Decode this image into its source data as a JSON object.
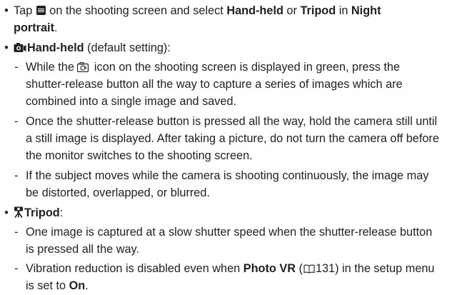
{
  "b1": {
    "pre": "Tap ",
    "mid1": " on the shooting screen and select ",
    "opt1": "Hand-held",
    "or": " or ",
    "opt2": "Tripod",
    "in": " in ",
    "mode_l1": "Night",
    "mode_l2": "portrait",
    "end": "."
  },
  "b2": {
    "label": "Hand-held",
    "suffix": " (default setting):",
    "d1_l1a": "While the ",
    "d1_l1b": " icon on the shooting screen is displayed in green, press the",
    "d1_l2": "shutter-release button all the way to capture a series of images which are",
    "d1_l3": "combined into a single image and saved.",
    "d2_l1": "Once the shutter-release button is pressed all the way, hold the camera still until",
    "d2_l2": "a still image is displayed. After taking a picture, do not turn the camera off before",
    "d2_l3": "the monitor switches to the shooting screen.",
    "d3_l1": "If the subject moves while the camera is shooting continuously, the image may",
    "d3_l2": "be distorted, overlapped, or blurred."
  },
  "b3": {
    "label": "Tripod",
    "colon": ":",
    "d1_l1": "One image is captured at a slow shutter speed when the shutter-release button",
    "d1_l2": "is pressed all the way.",
    "d2_l1a": "Vibration reduction is disabled even when ",
    "d2_bold": "Photo VR",
    "d2_ref_open": " (",
    "d2_ref_page": "131",
    "d2_l1b": ") in the setup menu",
    "d2_l2a": "is set to ",
    "d2_l2b": "On",
    "d2_l2c": "."
  },
  "symbols": {
    "bullet": "•",
    "dash": "-"
  },
  "icons": [
    "menu-icon",
    "handheld-camera-icon",
    "night-portrait-icon",
    "tripod-icon",
    "reference-book-icon"
  ]
}
